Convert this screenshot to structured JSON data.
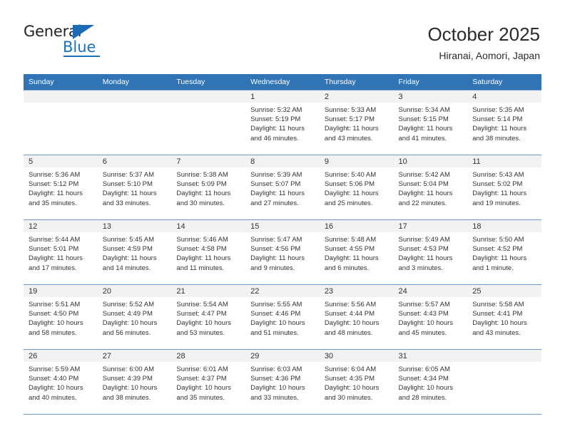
{
  "logo": {
    "word_top": "General",
    "word_bottom": "Blue",
    "triangle_icon": "blue-triangle-icon",
    "accent_color": "#1b72bb"
  },
  "header": {
    "title": "October 2025",
    "subtitle": "Hiranai, Aomori, Japan"
  },
  "calendar": {
    "header_bg": "#3074b5",
    "weekdays": [
      "Sunday",
      "Monday",
      "Tuesday",
      "Wednesday",
      "Thursday",
      "Friday",
      "Saturday"
    ],
    "weeks": [
      [
        {
          "day": "",
          "empty": true
        },
        {
          "day": "",
          "empty": true
        },
        {
          "day": "",
          "empty": true
        },
        {
          "day": "1",
          "sunrise": "Sunrise: 5:32 AM",
          "sunset": "Sunset: 5:19 PM",
          "daylight1": "Daylight: 11 hours",
          "daylight2": "and 46 minutes."
        },
        {
          "day": "2",
          "sunrise": "Sunrise: 5:33 AM",
          "sunset": "Sunset: 5:17 PM",
          "daylight1": "Daylight: 11 hours",
          "daylight2": "and 43 minutes."
        },
        {
          "day": "3",
          "sunrise": "Sunrise: 5:34 AM",
          "sunset": "Sunset: 5:15 PM",
          "daylight1": "Daylight: 11 hours",
          "daylight2": "and 41 minutes."
        },
        {
          "day": "4",
          "sunrise": "Sunrise: 5:35 AM",
          "sunset": "Sunset: 5:14 PM",
          "daylight1": "Daylight: 11 hours",
          "daylight2": "and 38 minutes."
        }
      ],
      [
        {
          "day": "5",
          "sunrise": "Sunrise: 5:36 AM",
          "sunset": "Sunset: 5:12 PM",
          "daylight1": "Daylight: 11 hours",
          "daylight2": "and 35 minutes."
        },
        {
          "day": "6",
          "sunrise": "Sunrise: 5:37 AM",
          "sunset": "Sunset: 5:10 PM",
          "daylight1": "Daylight: 11 hours",
          "daylight2": "and 33 minutes."
        },
        {
          "day": "7",
          "sunrise": "Sunrise: 5:38 AM",
          "sunset": "Sunset: 5:09 PM",
          "daylight1": "Daylight: 11 hours",
          "daylight2": "and 30 minutes."
        },
        {
          "day": "8",
          "sunrise": "Sunrise: 5:39 AM",
          "sunset": "Sunset: 5:07 PM",
          "daylight1": "Daylight: 11 hours",
          "daylight2": "and 27 minutes."
        },
        {
          "day": "9",
          "sunrise": "Sunrise: 5:40 AM",
          "sunset": "Sunset: 5:06 PM",
          "daylight1": "Daylight: 11 hours",
          "daylight2": "and 25 minutes."
        },
        {
          "day": "10",
          "sunrise": "Sunrise: 5:42 AM",
          "sunset": "Sunset: 5:04 PM",
          "daylight1": "Daylight: 11 hours",
          "daylight2": "and 22 minutes."
        },
        {
          "day": "11",
          "sunrise": "Sunrise: 5:43 AM",
          "sunset": "Sunset: 5:02 PM",
          "daylight1": "Daylight: 11 hours",
          "daylight2": "and 19 minutes."
        }
      ],
      [
        {
          "day": "12",
          "sunrise": "Sunrise: 5:44 AM",
          "sunset": "Sunset: 5:01 PM",
          "daylight1": "Daylight: 11 hours",
          "daylight2": "and 17 minutes."
        },
        {
          "day": "13",
          "sunrise": "Sunrise: 5:45 AM",
          "sunset": "Sunset: 4:59 PM",
          "daylight1": "Daylight: 11 hours",
          "daylight2": "and 14 minutes."
        },
        {
          "day": "14",
          "sunrise": "Sunrise: 5:46 AM",
          "sunset": "Sunset: 4:58 PM",
          "daylight1": "Daylight: 11 hours",
          "daylight2": "and 11 minutes."
        },
        {
          "day": "15",
          "sunrise": "Sunrise: 5:47 AM",
          "sunset": "Sunset: 4:56 PM",
          "daylight1": "Daylight: 11 hours",
          "daylight2": "and 9 minutes."
        },
        {
          "day": "16",
          "sunrise": "Sunrise: 5:48 AM",
          "sunset": "Sunset: 4:55 PM",
          "daylight1": "Daylight: 11 hours",
          "daylight2": "and 6 minutes."
        },
        {
          "day": "17",
          "sunrise": "Sunrise: 5:49 AM",
          "sunset": "Sunset: 4:53 PM",
          "daylight1": "Daylight: 11 hours",
          "daylight2": "and 3 minutes."
        },
        {
          "day": "18",
          "sunrise": "Sunrise: 5:50 AM",
          "sunset": "Sunset: 4:52 PM",
          "daylight1": "Daylight: 11 hours",
          "daylight2": "and 1 minute."
        }
      ],
      [
        {
          "day": "19",
          "sunrise": "Sunrise: 5:51 AM",
          "sunset": "Sunset: 4:50 PM",
          "daylight1": "Daylight: 10 hours",
          "daylight2": "and 58 minutes."
        },
        {
          "day": "20",
          "sunrise": "Sunrise: 5:52 AM",
          "sunset": "Sunset: 4:49 PM",
          "daylight1": "Daylight: 10 hours",
          "daylight2": "and 56 minutes."
        },
        {
          "day": "21",
          "sunrise": "Sunrise: 5:54 AM",
          "sunset": "Sunset: 4:47 PM",
          "daylight1": "Daylight: 10 hours",
          "daylight2": "and 53 minutes."
        },
        {
          "day": "22",
          "sunrise": "Sunrise: 5:55 AM",
          "sunset": "Sunset: 4:46 PM",
          "daylight1": "Daylight: 10 hours",
          "daylight2": "and 51 minutes."
        },
        {
          "day": "23",
          "sunrise": "Sunrise: 5:56 AM",
          "sunset": "Sunset: 4:44 PM",
          "daylight1": "Daylight: 10 hours",
          "daylight2": "and 48 minutes."
        },
        {
          "day": "24",
          "sunrise": "Sunrise: 5:57 AM",
          "sunset": "Sunset: 4:43 PM",
          "daylight1": "Daylight: 10 hours",
          "daylight2": "and 45 minutes."
        },
        {
          "day": "25",
          "sunrise": "Sunrise: 5:58 AM",
          "sunset": "Sunset: 4:41 PM",
          "daylight1": "Daylight: 10 hours",
          "daylight2": "and 43 minutes."
        }
      ],
      [
        {
          "day": "26",
          "sunrise": "Sunrise: 5:59 AM",
          "sunset": "Sunset: 4:40 PM",
          "daylight1": "Daylight: 10 hours",
          "daylight2": "and 40 minutes."
        },
        {
          "day": "27",
          "sunrise": "Sunrise: 6:00 AM",
          "sunset": "Sunset: 4:39 PM",
          "daylight1": "Daylight: 10 hours",
          "daylight2": "and 38 minutes."
        },
        {
          "day": "28",
          "sunrise": "Sunrise: 6:01 AM",
          "sunset": "Sunset: 4:37 PM",
          "daylight1": "Daylight: 10 hours",
          "daylight2": "and 35 minutes."
        },
        {
          "day": "29",
          "sunrise": "Sunrise: 6:03 AM",
          "sunset": "Sunset: 4:36 PM",
          "daylight1": "Daylight: 10 hours",
          "daylight2": "and 33 minutes."
        },
        {
          "day": "30",
          "sunrise": "Sunrise: 6:04 AM",
          "sunset": "Sunset: 4:35 PM",
          "daylight1": "Daylight: 10 hours",
          "daylight2": "and 30 minutes."
        },
        {
          "day": "31",
          "sunrise": "Sunrise: 6:05 AM",
          "sunset": "Sunset: 4:34 PM",
          "daylight1": "Daylight: 10 hours",
          "daylight2": "and 28 minutes."
        },
        {
          "day": "",
          "empty": true
        }
      ]
    ]
  }
}
